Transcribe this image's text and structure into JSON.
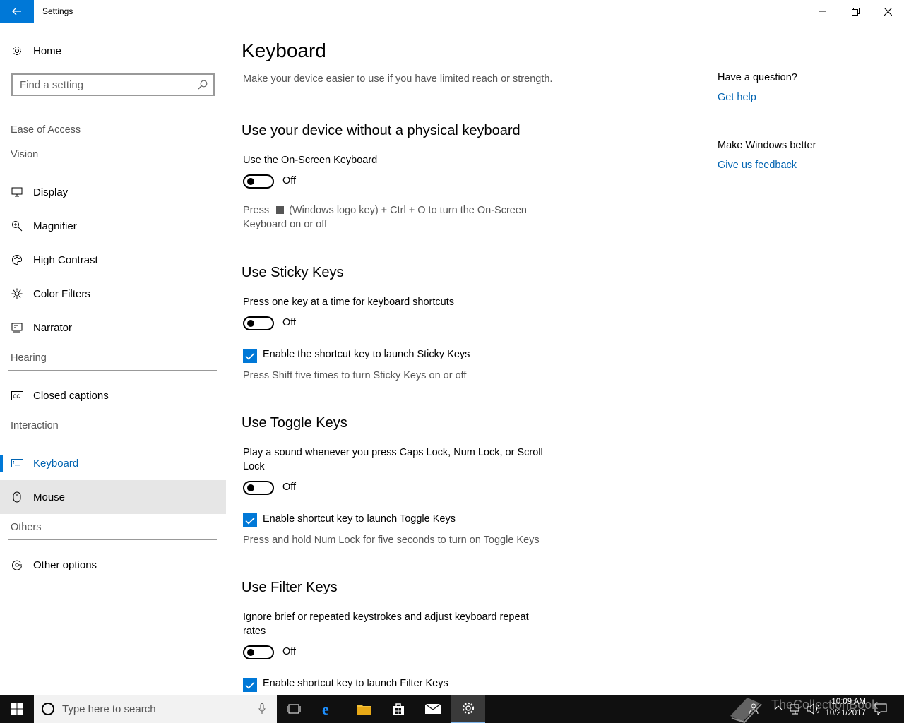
{
  "window": {
    "title": "Settings"
  },
  "sidebar": {
    "home_label": "Home",
    "search_placeholder": "Find a setting",
    "category": "Ease of Access",
    "groups": {
      "vision": "Vision",
      "hearing": "Hearing",
      "interaction": "Interaction",
      "others": "Others"
    },
    "items": {
      "display": "Display",
      "magnifier": "Magnifier",
      "high_contrast": "High Contrast",
      "color_filters": "Color Filters",
      "narrator": "Narrator",
      "closed_captions": "Closed captions",
      "keyboard": "Keyboard",
      "mouse": "Mouse",
      "other_options": "Other options"
    },
    "active_item": "Keyboard",
    "accent_color": "#0078d7"
  },
  "main": {
    "title": "Keyboard",
    "intro": "Make your device easier to use if you have limited reach or strength.",
    "onscreen": {
      "heading": "Use your device without a physical keyboard",
      "label": "Use the On-Screen Keyboard",
      "state": "Off",
      "note_prefix": "Press",
      "note_suffix": "(Windows logo key) + Ctrl + O to turn the On-Screen Keyboard on or off"
    },
    "sticky": {
      "heading": "Use Sticky Keys",
      "label": "Press one key at a time for keyboard shortcuts",
      "state": "Off",
      "checkbox_label": "Enable the shortcut key to launch Sticky Keys",
      "checked": true,
      "note": "Press Shift five times to turn Sticky Keys on or off"
    },
    "toggle_keys": {
      "heading": "Use Toggle Keys",
      "label": "Play a sound whenever you press Caps Lock, Num Lock, or Scroll Lock",
      "state": "Off",
      "checkbox_label": "Enable shortcut key to launch Toggle Keys",
      "checked": true,
      "note": "Press and hold Num Lock for five seconds to turn on Toggle Keys"
    },
    "filter_keys": {
      "heading": "Use Filter Keys",
      "label": "Ignore brief or repeated keystrokes and adjust keyboard repeat rates",
      "state": "Off",
      "checkbox_label": "Enable shortcut key to launch Filter Keys",
      "checked": true
    }
  },
  "aside": {
    "question_heading": "Have a question?",
    "help_link": "Get help",
    "feedback_heading": "Make Windows better",
    "feedback_link": "Give us feedback"
  },
  "taskbar": {
    "search_placeholder": "Type here to search",
    "time": "10:09 AM",
    "date": "10/21/2017",
    "watermark": "TheCollectionBook"
  }
}
